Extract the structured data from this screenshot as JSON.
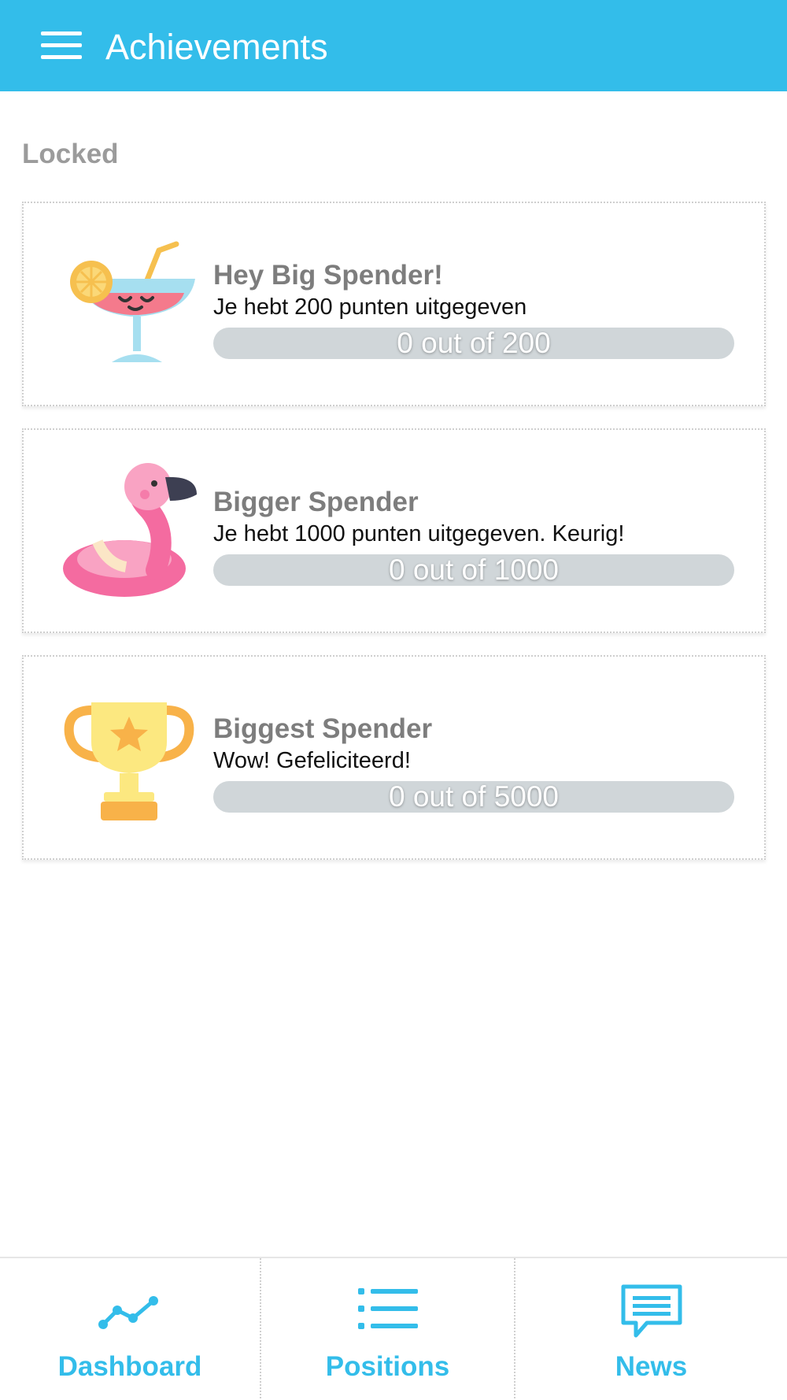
{
  "app_bar": {
    "title": "Achievements",
    "menu_icon": "hamburger-menu-icon",
    "background_color": "#33bdea"
  },
  "section": {
    "label": "Locked"
  },
  "achievements": [
    {
      "title": "Hey Big Spender!",
      "description": "Je hebt 200 punten uitgegeven",
      "icon": "cocktail-icon",
      "progress_current": 0,
      "progress_target": 200,
      "progress_text": "0 out of 200"
    },
    {
      "title": "Bigger Spender",
      "description": "Je hebt 1000 punten uitgegeven. Keurig!",
      "icon": "flamingo-float-icon",
      "progress_current": 0,
      "progress_target": 1000,
      "progress_text": "0 out of 1000"
    },
    {
      "title": "Biggest Spender",
      "description": "Wow! Gefeliciteerd!",
      "icon": "trophy-icon",
      "progress_current": 0,
      "progress_target": 5000,
      "progress_text": "0 out of 5000"
    }
  ],
  "bottom_nav": [
    {
      "label": "Dashboard",
      "icon": "line-chart-icon"
    },
    {
      "label": "Positions",
      "icon": "list-icon"
    },
    {
      "label": "News",
      "icon": "chat-bubble-icon"
    }
  ],
  "colors": {
    "accent": "#33bdea",
    "progress_track": "#d0d6d9",
    "muted_text": "#9b9b9b"
  }
}
